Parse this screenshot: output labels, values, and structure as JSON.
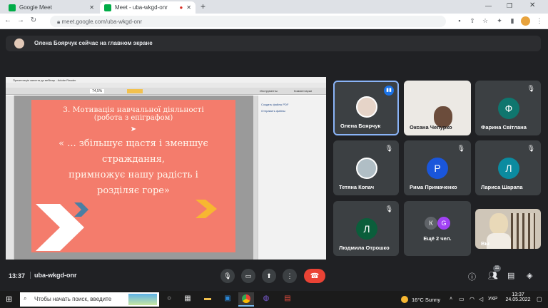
{
  "browser": {
    "tabs": [
      {
        "title": "Google Meet"
      },
      {
        "title": "Meet - uba-wkgd-onr"
      }
    ],
    "new_tab": "+",
    "url": "meet.google.com/uba-wkgd-onr"
  },
  "meet": {
    "notice": "Олена Боярчук сейчас на главном экране",
    "presentation": {
      "viewer_title": "Презентація заняття до вебінар - Adobe Reader",
      "zoom": "74,5%",
      "side_buttons": [
        "Инструменты",
        "Комментарии"
      ],
      "side_links": [
        "Создать файлы PDF",
        "Отправить файлы"
      ],
      "slide_heading_line1": "3. Мотивація навчальної діяльності",
      "slide_heading_line2": "(робота з епіграфом)",
      "slide_quote": [
        "« ... збільшує щастя і зменшує",
        "страждання,",
        "примножує нашу радість і",
        "розділяє горе»"
      ]
    },
    "participants": [
      {
        "name": "Олена Боярчук",
        "initial": "",
        "color": "#8ab4f8",
        "speaking": true
      },
      {
        "name": "Оксана Чепурко",
        "initial": "",
        "color": "#5f6368"
      },
      {
        "name": "Фарина Світлана",
        "initial": "Ф",
        "color": "#0f766e",
        "muted": true
      },
      {
        "name": "Тетяна Копач",
        "initial": "",
        "color": "#b0bec5",
        "muted": true
      },
      {
        "name": "Рима Примаченко",
        "initial": "Р",
        "color": "#1a56db",
        "muted": true
      },
      {
        "name": "Лариса Шарапа",
        "initial": "Л",
        "color": "#0b8ba0",
        "muted": true
      },
      {
        "name": "Людмила Отрошко",
        "initial": "Л",
        "color": "#0b5e3b",
        "muted": true
      },
      {
        "name": "Ещё 2 чел.",
        "initial": "",
        "color": "#3c4043"
      },
      {
        "name": "Вы",
        "initial": "",
        "color": "#cfc6b8"
      }
    ],
    "extra_initials": [
      "К",
      "G"
    ],
    "time": "13:37",
    "meeting_code": "uba-wkgd-onr",
    "people_count": "11"
  },
  "taskbar": {
    "search_placeholder": "Чтобы начать поиск, введите",
    "weather": "16°C  Sunny",
    "lang": "УКР",
    "time": "13:37",
    "date": "24.05.2022"
  },
  "colors": {
    "meet_bg": "#202124",
    "slide_bg": "#f47c6c",
    "end_call": "#ea4335",
    "speaking_border": "#8ab4f8",
    "arrow_yellow": "#f7b731",
    "arrow_blue": "#4b7fa3"
  }
}
